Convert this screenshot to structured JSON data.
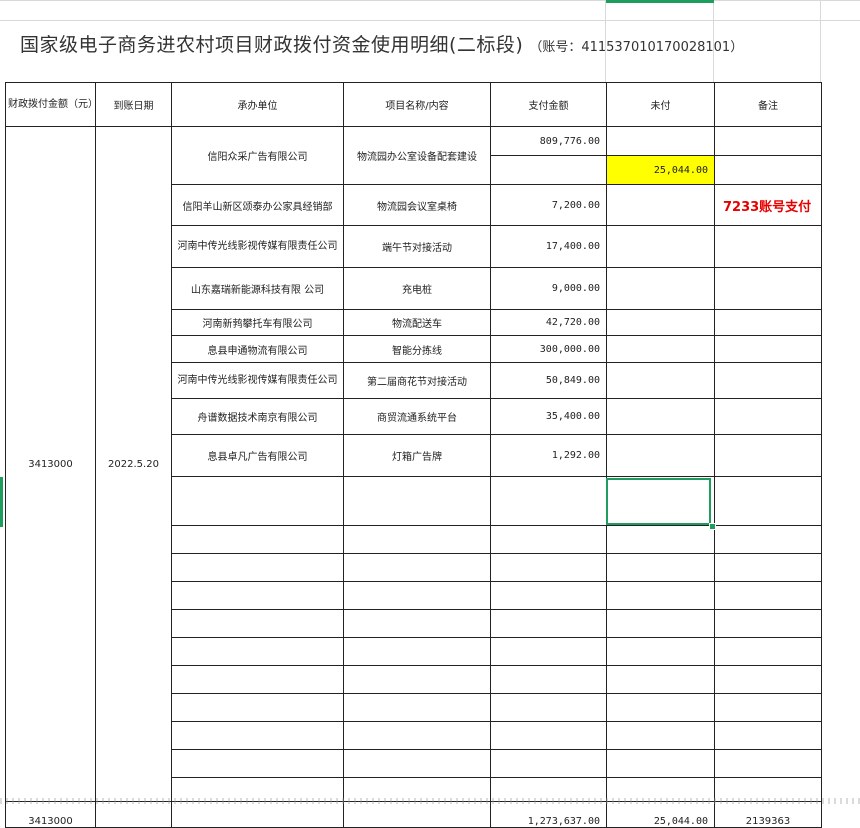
{
  "sheet": {
    "title": "国家级电子商务进农村项目财政拨付资金使用明细(二标段)",
    "account": "（账号：411537010170028101）"
  },
  "headers": {
    "funding": "财政拨付金额（元）",
    "date": "到账日期",
    "unit": "承办单位",
    "project": "项目名称/内容",
    "paid": "支付金额",
    "unpaid": "未付",
    "remark": "备注"
  },
  "group": {
    "funding": "3413000",
    "date": "2022.5.20"
  },
  "rows": [
    {
      "unit": "信阳众采广告有限公司",
      "project": "物流园办公室设备配套建设",
      "paid": "809,776.00",
      "unpaid": "25,044.00",
      "remark": ""
    },
    {
      "unit": "信阳羊山新区颂泰办公家具经销部",
      "project": "物流园会议室桌椅",
      "paid": "7,200.00",
      "unpaid": "",
      "remark": "7233账号支付"
    },
    {
      "unit": "河南中传光线影视传媒有限责任公司",
      "project": "端午节对接活动",
      "paid": "17,400.00",
      "unpaid": "",
      "remark": ""
    },
    {
      "unit": "山东嘉瑞新能源科技有限 公司",
      "project": "充电桩",
      "paid": "9,000.00",
      "unpaid": "",
      "remark": ""
    },
    {
      "unit": "河南新鹁攀托车有限公司",
      "project": "物流配送车",
      "paid": "42,720.00",
      "unpaid": "",
      "remark": ""
    },
    {
      "unit": "息县申通物流有限公司",
      "project": "智能分拣线",
      "paid": "300,000.00",
      "unpaid": "",
      "remark": ""
    },
    {
      "unit": "河南中传光线影视传媒有限责任公司",
      "project": "第二届商花节对接活动",
      "paid": "50,849.00",
      "unpaid": "",
      "remark": ""
    },
    {
      "unit": "舟谱数据技术南京有限公司",
      "project": "商贸流通系统平台",
      "paid": "35,400.00",
      "unpaid": "",
      "remark": ""
    },
    {
      "unit": "息县卓凡广告有限公司",
      "project": "灯箱广告牌",
      "paid": "1,292.00",
      "unpaid": "",
      "remark": ""
    }
  ],
  "totals": {
    "funding": "3413000",
    "paid": "1,273,637.00",
    "unpaid": "25,044.00",
    "remark": "2139363"
  }
}
